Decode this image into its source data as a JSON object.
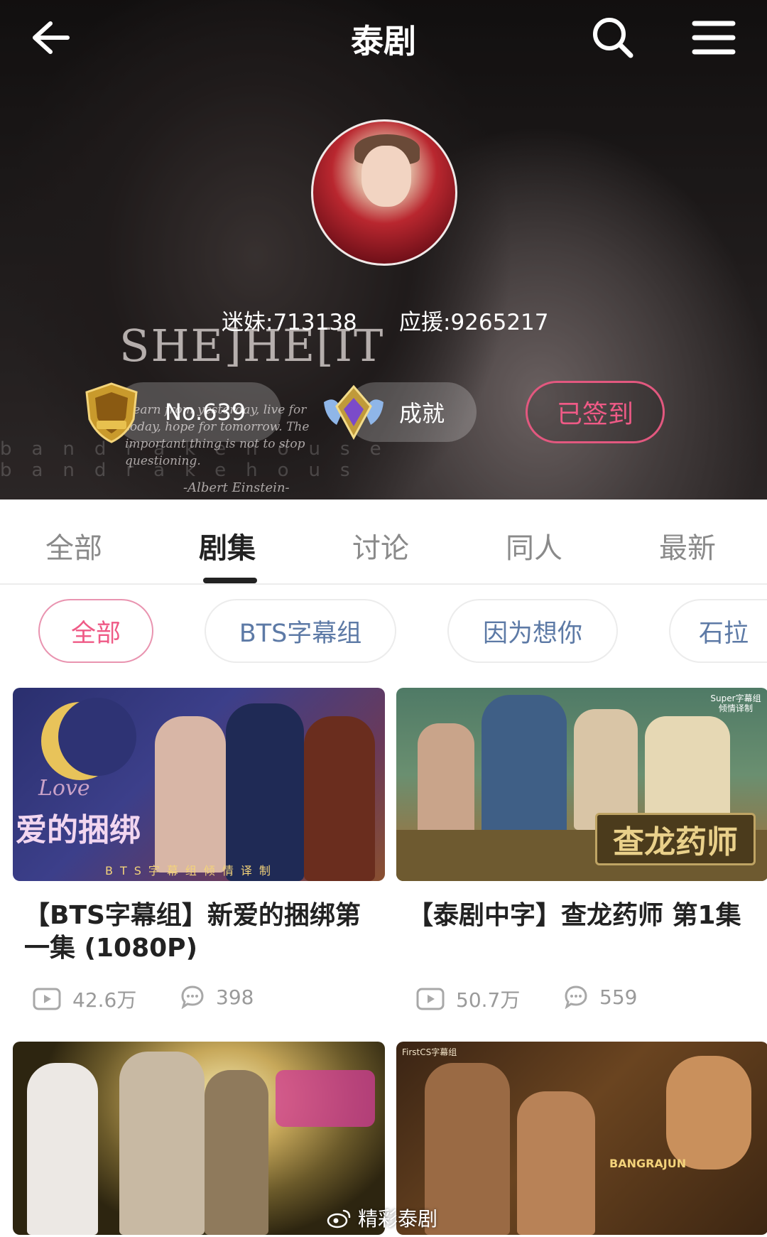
{
  "header": {
    "title": "泰剧",
    "shirt_text": "SHE]HE[IT",
    "quote": "Learn from yesterday, live for today, hope for tomorrow. The important thing is not to stop questioning.",
    "quote_author": "-Albert Einstein-",
    "watermark": "bandrakehouse  bandrakehous"
  },
  "stats": {
    "fans": "迷妹:713138",
    "support": "应援:9265217"
  },
  "actions": {
    "rank_label": "No.639",
    "achievement_label": "成就",
    "signed_label": "已签到"
  },
  "tabs": [
    "全部",
    "剧集",
    "讨论",
    "同人",
    "最新"
  ],
  "filters": [
    "全部",
    "BTS字幕组",
    "因为想你",
    "石拉"
  ],
  "cards": [
    {
      "title": "【BTS字幕组】新爱的捆绑第一集 (1080P)",
      "views": "42.6万",
      "comments": "398"
    },
    {
      "title": "【泰剧中字】查龙药师 第1集",
      "views": "50.7万",
      "comments": "559"
    },
    {
      "title": "",
      "views": "",
      "comments": ""
    },
    {
      "title": "",
      "views": "",
      "comments": ""
    }
  ],
  "thumb_text": {
    "card1_logo": "Love",
    "card1_cn": "爱的捆绑",
    "card1_sub": "BTS字幕组倾情译制",
    "card2_cn": "查龙药师",
    "card2_badge": "Super字幕组 倾情译制",
    "card4_corner": "FirstCS字幕组",
    "card4_title": "BANGRAJUN"
  },
  "watermark_footer": "精彩泰剧",
  "colors": {
    "accent_pink": "#ef5a86",
    "chip_blue": "#5d7aa6",
    "tab_active": "#222222"
  }
}
